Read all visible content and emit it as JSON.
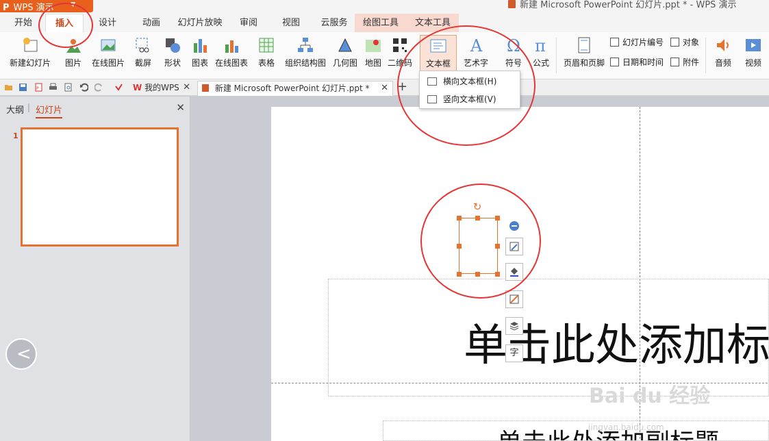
{
  "app": {
    "name": "WPS 演示",
    "window_title": "新建 Microsoft PowerPoint 幻灯片.ppt * - WPS 演示"
  },
  "tabs": [
    "开始",
    "插入",
    "设计",
    "动画",
    "幻灯片放映",
    "审阅",
    "视图",
    "云服务",
    "绘图工具",
    "文本工具"
  ],
  "active_tab": "插入",
  "ribbon": {
    "new_slide": "新建幻灯片",
    "picture": "图片",
    "online_picture": "在线图片",
    "screenshot": "截屏",
    "shapes": "形状",
    "chart": "图表",
    "online_chart": "在线图表",
    "table": "表格",
    "smartart": "组织结构图",
    "geometry": "几何图",
    "map": "地图",
    "qrcode": "二维码",
    "textbox": "文本框",
    "wordart": "艺术字",
    "symbol": "符号",
    "formula": "公式",
    "header_footer": "页眉和页脚",
    "slide_number": "幻灯片编号",
    "object": "对象",
    "datetime": "日期和时间",
    "attachment": "附件",
    "audio": "音频",
    "video": "视频"
  },
  "doc_tabs": {
    "home": "我的WPS",
    "document": "新建 Microsoft PowerPoint 幻灯片.ppt *"
  },
  "left_panel": {
    "outline_tab": "大纲",
    "slides_tab": "幻灯片",
    "slide_number": "1"
  },
  "textbox_menu": {
    "horizontal": "横向文本框(H)",
    "vertical": "竖向文本框(V)"
  },
  "slide": {
    "title_placeholder": "单击此处添加标",
    "subtitle_placeholder": "单击此处添加副标题"
  },
  "floating_tools": {
    "text_tool": "字"
  },
  "watermark": {
    "main": "Bai du 经验",
    "url": "jingyan.baidu.com"
  },
  "colors": {
    "accent": "#e6722f",
    "annotation": "#e53535",
    "brand": "#e8601c"
  }
}
